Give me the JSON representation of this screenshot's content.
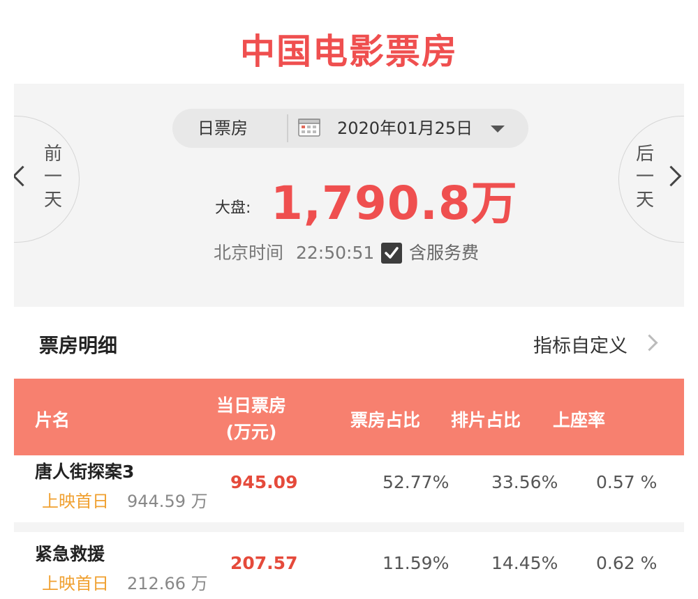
{
  "title": "中国电影票房",
  "nav": {
    "prev_label": "前一天",
    "next_label": "后一天",
    "type_label": "日票房",
    "date": "2020年01月25日"
  },
  "summary": {
    "total_label": "大盘:",
    "total_value": "1,790.8万",
    "time_label": "北京时间",
    "time_value": "22:50:51",
    "fee_label": "含服务费",
    "fee_checked": true
  },
  "section": {
    "title": "票房明细",
    "custom_label": "指标自定义"
  },
  "table": {
    "headers": {
      "name": "片名",
      "gross_line1": "当日票房",
      "gross_line2": "(万元)",
      "share": "票房占比",
      "showtime": "排片占比",
      "seat": "上座率"
    },
    "rows": [
      {
        "name": "唐人街探案3",
        "release_tag": "上映首日",
        "release_gross": "944.59 万",
        "gross": "945.09",
        "share": "52.77%",
        "showtime": "33.56%",
        "seat": "0.57 %"
      },
      {
        "name": "紧急救援",
        "release_tag": "上映首日",
        "release_gross": "212.66 万",
        "gross": "207.57",
        "share": "11.59%",
        "showtime": "14.45%",
        "seat": "0.62 %"
      }
    ]
  },
  "colors": {
    "accent": "#ef4f4f",
    "header_bg": "#f7806f",
    "release_tag": "#f0a030"
  }
}
